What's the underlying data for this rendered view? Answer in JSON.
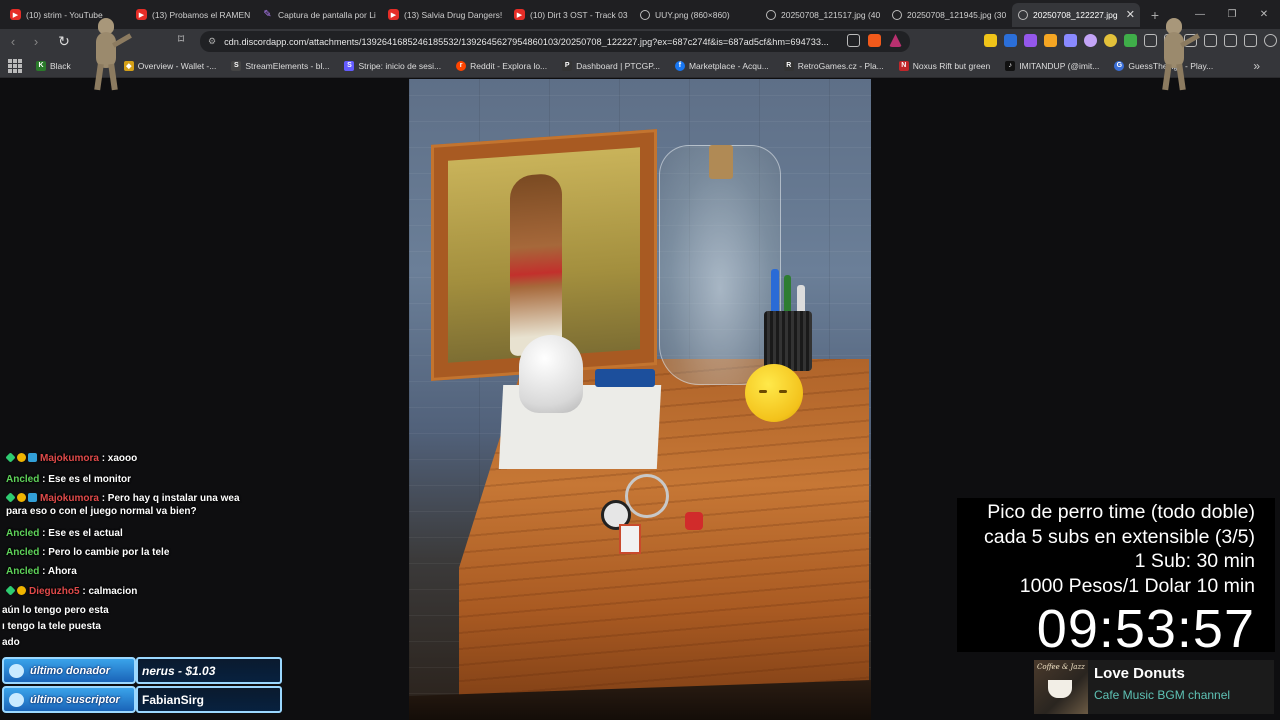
{
  "browser": {
    "tabs": [
      {
        "label": "(10) strim - YouTube",
        "icon": "youtube-icon"
      },
      {
        "label": "(13) Probamos el RAMEN",
        "icon": "youtube-icon"
      },
      {
        "label": "Captura de pantalla por Li",
        "icon": "pen-icon"
      },
      {
        "label": "(13) Salvia Drug Dangers!",
        "icon": "youtube-icon"
      },
      {
        "label": "(10) Dirt 3 OST - Track 03",
        "icon": "youtube-icon"
      },
      {
        "label": "UUY.png (860×860)",
        "icon": "globe-icon"
      },
      {
        "label": "20250708_121517.jpg (40",
        "icon": "globe-icon"
      },
      {
        "label": "20250708_121945.jpg (30",
        "icon": "globe-icon"
      },
      {
        "label": "20250708_122227.jpg",
        "icon": "globe-icon",
        "active": true
      }
    ],
    "url": "cdn.discordapp.com/attachments/1392641685246185532/1392645627954860103/20250708_122227.jpg?ex=687c274f&is=687ad5cf&hm=694733...",
    "bookmarks": [
      {
        "label": "Black",
        "icon_color": "#2a7a2a",
        "glyph": "K"
      },
      {
        "label": "Overview - Wallet -...",
        "icon_color": "#d4a017",
        "glyph": "◆"
      },
      {
        "label": "StreamElements - bl...",
        "icon_color": "#444",
        "glyph": "S"
      },
      {
        "label": "Stripe: inicio de sesi...",
        "icon_color": "#635bff",
        "glyph": "S"
      },
      {
        "label": "Reddit - Explora lo...",
        "icon_color": "#ff4500",
        "glyph": "r"
      },
      {
        "label": "Dashboard | PTCGP...",
        "icon_color": "#333",
        "glyph": "P"
      },
      {
        "label": "Marketplace - Acqu...",
        "icon_color": "#1877f2",
        "glyph": "f"
      },
      {
        "label": "RetroGames.cz - Pla...",
        "icon_color": "#333",
        "glyph": "R"
      },
      {
        "label": "Noxus Rift but green",
        "icon_color": "#c0262a",
        "glyph": "N"
      },
      {
        "label": "IMITANDUP (@imit...",
        "icon_color": "#111",
        "glyph": "♪"
      },
      {
        "label": "GuessTheAge - Play...",
        "icon_color": "#3a6fd8",
        "glyph": "G"
      }
    ]
  },
  "chat": {
    "messages": [
      {
        "user": "Majokumora",
        "text": ": xaooo",
        "user_color": "red",
        "badges": true
      },
      {
        "user": "Ancled",
        "text": ": Ese es el monitor",
        "user_color": "green",
        "badges": false
      },
      {
        "user": "Majokumora",
        "text": ": Pero hay q instalar una wea para eso o con el juego normal va bien?",
        "user_color": "red",
        "badges": true
      },
      {
        "user": "Ancled",
        "text": ": Ese es el actual",
        "user_color": "green",
        "badges": false
      },
      {
        "user": "Ancled",
        "text": ": Pero lo cambie por la tele",
        "user_color": "green",
        "badges": false
      },
      {
        "user": "Ancled",
        "text": ": Ahora",
        "user_color": "green",
        "badges": false
      },
      {
        "user": "Dieguzho5",
        "text": ": calmacion",
        "user_color": "red",
        "badges": true
      }
    ],
    "partial_lines": [
      "aún lo tengo pero esta",
      "ı tengo la tele puesta",
      "ado"
    ]
  },
  "overlay": {
    "last_donor_label": "último donador",
    "last_donor_value": "nerus - $1.03",
    "last_sub_label": "último suscriptor",
    "last_sub_value": "FabianSirg"
  },
  "stream_info": {
    "line1": "Pico de perro time (todo doble)",
    "line2": "cada 5 subs en extensible (3/5)",
    "line3": "1 Sub: 30 min",
    "line4": "1000 Pesos/1 Dolar 10 min",
    "timer": "09:53:57"
  },
  "music": {
    "title": "Love Donuts",
    "artist": "Cafe Music BGM channel",
    "art_label": "Coffee & Jazz"
  },
  "colors": {
    "accent_teal": "#5ec2b5",
    "chat_red_user": "#e04a4a",
    "chat_green_user": "#5fd35a",
    "overlay_blue": "#1a64b8"
  }
}
